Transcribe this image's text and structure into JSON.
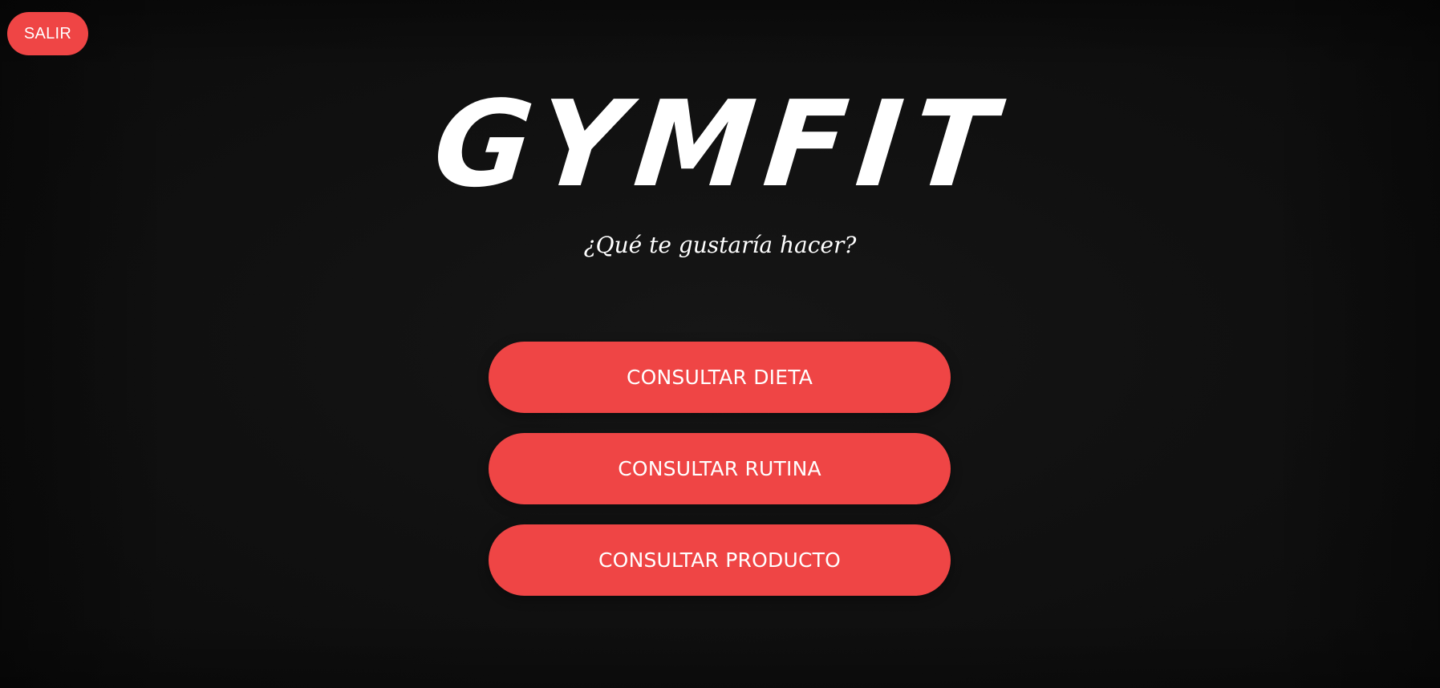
{
  "header": {
    "exit_label": "SALIR"
  },
  "brand": {
    "title": "GYMFIT"
  },
  "main": {
    "subtitle": "¿Qué te gustaría hacer?",
    "actions": [
      {
        "label": "CONSULTAR DIETA"
      },
      {
        "label": "CONSULTAR RUTINA"
      },
      {
        "label": "CONSULTAR PRODUCTO"
      }
    ]
  },
  "colors": {
    "accent": "#ef4545",
    "background": "#111111",
    "text": "#ffffff"
  }
}
